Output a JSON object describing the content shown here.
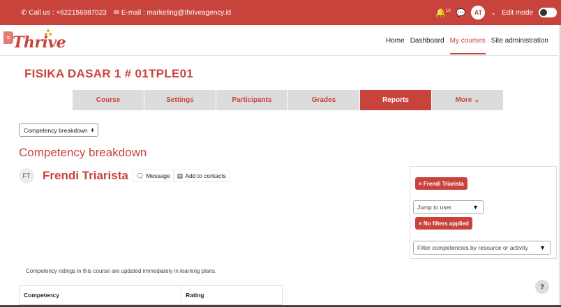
{
  "topbar": {
    "call_label": "Call us : +622156987023",
    "email_label": "E-mail : marketing@thriveagency.id",
    "avatar_initials": "AT",
    "notification_count": "10",
    "edit_mode_label": "Edit mode"
  },
  "brand": {
    "logo_text": "Thrive",
    "accent_color": "#c8433c"
  },
  "nav": {
    "items": [
      "Home",
      "Dashboard",
      "My courses",
      "Site administration"
    ],
    "active": "My courses"
  },
  "course": {
    "title": "FISIKA DASAR 1 # 01TPLE01"
  },
  "tabs": [
    {
      "label": "Course"
    },
    {
      "label": "Settings"
    },
    {
      "label": "Participants"
    },
    {
      "label": "Grades"
    },
    {
      "label": "Reports"
    },
    {
      "label": "More ⌄"
    }
  ],
  "active_tab": "Reports",
  "report_select": {
    "value": "Competency breakdown"
  },
  "page": {
    "heading": "Competency breakdown"
  },
  "user": {
    "initials": "FT",
    "name": "Frendi Triarista",
    "message_label": "Message",
    "add_contacts_label": "Add to contacts"
  },
  "filters": {
    "user_chip": "× Frendi Triarista",
    "jump_to_user": "Jump to user",
    "no_filters_chip": "× No filters applied",
    "filter_placeholder": "Filter competencies by resource or activity"
  },
  "note": "Competency ratings in this course are updated immediately in learning plans.",
  "table": {
    "headers": [
      "Competency",
      "Rating"
    ]
  },
  "help_label": "?"
}
